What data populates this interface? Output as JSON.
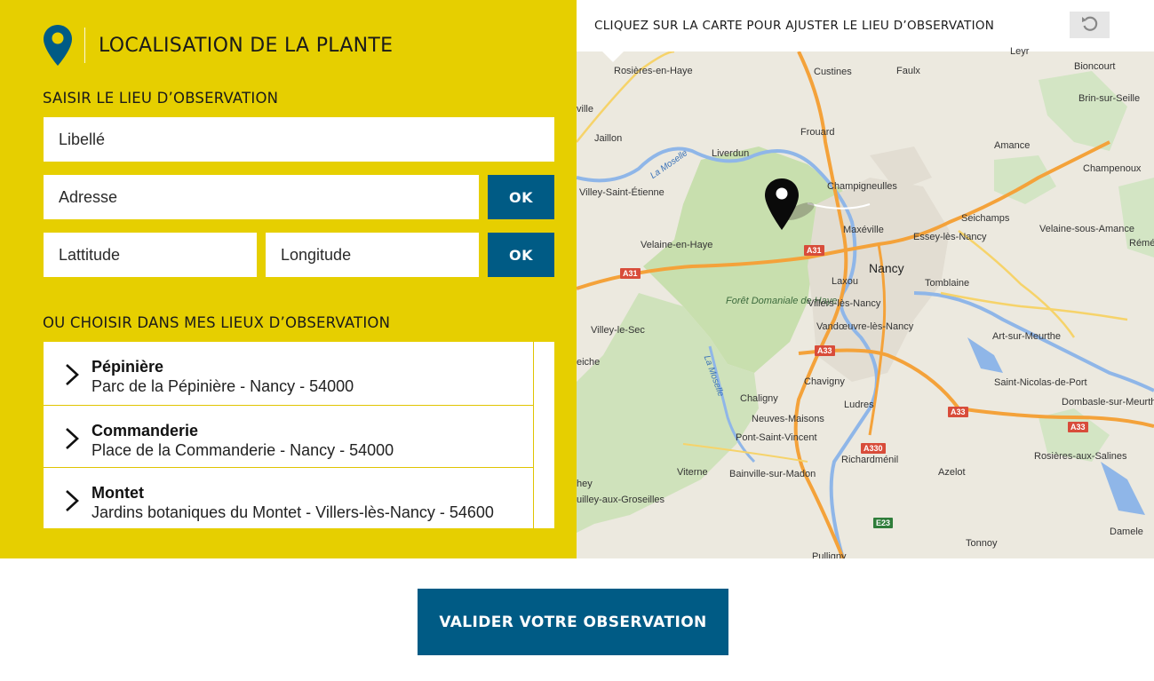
{
  "colors": {
    "yellow": "#e6cf00",
    "blue": "#005b85",
    "white": "#ffffff"
  },
  "header": {
    "title": "LOCALISATION DE LA PLANTE",
    "icon": "location-pin-icon"
  },
  "entry": {
    "section_title": "SAISIR LE LIEU D’OBSERVATION",
    "label_placeholder": "Libellé",
    "address_placeholder": "Adresse",
    "latitude_placeholder": "Lattitude",
    "longitude_placeholder": "Longitude",
    "ok_label": "OK"
  },
  "places": {
    "section_title": "OU CHOISIR DANS MES LIEUX D’OBSERVATION",
    "items": [
      {
        "name": "Pépinière",
        "address": "Parc de la Pépinière - Nancy - 54000"
      },
      {
        "name": "Commanderie",
        "address": "Place de la Commanderie - Nancy - 54000"
      },
      {
        "name": "Montet",
        "address": "Jardins botaniques du Montet - Villers-lès-Nancy - 54600"
      }
    ]
  },
  "map": {
    "instruction": "CLIQUEZ SUR LA CARTE POUR AJUSTER LE LIEU D’OBSERVATION",
    "reset_icon": "undo-icon",
    "forest": "Forêt Domaniale de Haye",
    "labels": {
      "rosieres_en_haye": "Rosières-en-Haye",
      "custines": "Custines",
      "faulx": "Faulx",
      "leyr": "Leyr",
      "bioncourt": "Bioncourt",
      "brin_sur_seille": "Brin-sur-Seille",
      "ville": "ville",
      "jaillon": "Jaillon",
      "frouard": "Frouard",
      "amance": "Amance",
      "liverdun": "Liverdun",
      "champenoux": "Champenoux",
      "la_moselle": "La Moselle",
      "villey_saint_etienne": "Villey-Saint-Étienne",
      "champigneulles": "Champigneulles",
      "seichamps": "Seichamps",
      "maxeville": "Maxéville",
      "velaine_sous_amance": "Velaine-sous-Amance",
      "velaine_en_haye": "Velaine-en-Haye",
      "essey_les_nancy": "Essey-lès-Nancy",
      "reme": "Rémé",
      "nancy": "Nancy",
      "laxou": "Laxou",
      "tomblaine": "Tomblaine",
      "villers_les_nancy": "Villers-lès-Nancy",
      "villey_le_sec": "Villey-le-Sec",
      "vandoeuvre": "Vandœuvre-lès-Nancy",
      "art_sur_meurthe": "Art-sur-Meurthe",
      "eiche": "eiche",
      "la_moselle_2": "La Moselle",
      "chavigny": "Chavigny",
      "saint_nicolas": "Saint-Nicolas-de-Port",
      "chaligny": "Chaligny",
      "ludres": "Ludres",
      "dombasle": "Dombasle-sur-Meurthe",
      "neuves_maisons": "Neuves-Maisons",
      "pont_saint_vincent": "Pont-Saint-Vincent",
      "richardmenil": "Richardménil",
      "rosieres_aux_salines": "Rosières-aux-Salines",
      "azelot": "Azelot",
      "viterne": "Viterne",
      "bainville": "Bainville-sur-Madon",
      "hey": "hey",
      "uilley": "uilley-aux-Groseilles",
      "damele": "Damele",
      "tonnoy": "Tonnoy",
      "pulligny": "Pulligny"
    },
    "roads": {
      "a31_west": "A31",
      "a31_east": "A31",
      "a33_center": "A33",
      "a33_east": "A33",
      "a33_far_east": "A33",
      "a330": "A330",
      "e23": "E23"
    }
  },
  "footer": {
    "validate_label": "VALIDER VOTRE OBSERVATION"
  }
}
